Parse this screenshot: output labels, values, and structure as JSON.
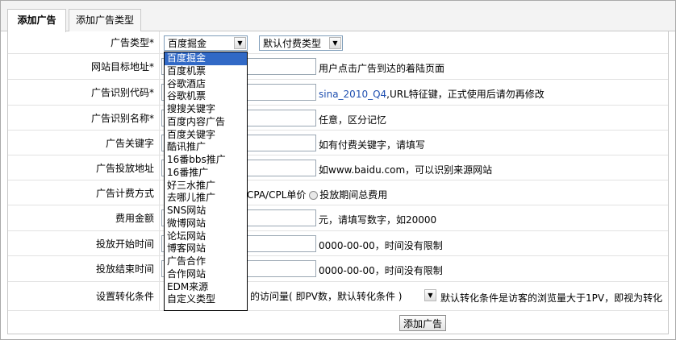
{
  "tabs": [
    {
      "label": "添加广告",
      "active": true
    },
    {
      "label": "添加广告类型",
      "active": false
    }
  ],
  "form": {
    "ad_type_label": "广告类型*",
    "ad_type_value": "百度掘金",
    "pay_type_value": "默认付费类型",
    "target_url_label": "网站目标地址*",
    "target_url_hint": "用户点击广告到达的着陆页面",
    "ad_code_label": "广告识别代码*",
    "ad_code_hint_code": "sina_2010_Q4",
    "ad_code_hint_text": ",URL特征键，正式使用后请勿再修改",
    "ad_name_label": "广告识别名称*",
    "ad_name_hint": "任意，区分记忆",
    "keyword_label": "广告关键字",
    "keyword_hint": "如有付费关键字，请填写",
    "placement_label": "广告投放地址",
    "placement_hint": "如www.baidu.com，可以识别来源网站",
    "billing_label": "广告计费方式",
    "billing_option_partial": "CPA/CPL单价",
    "billing_option_total": "投放期间总费用",
    "amount_label": "费用金额",
    "amount_hint": "元，请填写数字，如20000",
    "start_label": "投放开始时间",
    "start_hint": "0000-00-00，时间没有限制",
    "end_label": "投放结束时间",
    "end_hint": "0000-00-00，时间没有限制",
    "conversion_label": "设置转化条件",
    "conversion_select_value": "的访问量( 即PV数，默认转化条件 )",
    "conversion_hint": "默认转化条件是访客的浏览量大于1PV，即视为转化",
    "submit_label": "添加广告"
  },
  "dropdown_options": [
    "百度掘金",
    "百度机票",
    "谷歌酒店",
    "谷歌机票",
    "搜搜关键字",
    "百度内容广告",
    "百度关键字",
    "酷讯推广",
    "16番bbs推广",
    "16番推广",
    "好三水推广",
    "去哪儿推广",
    "SNS网站",
    "微博网站",
    "论坛网站",
    "博客网站",
    "广告合作",
    "合作网站",
    "EDM来源",
    "自定义类型"
  ],
  "icons": {
    "dropdown_arrow": "chevron-down-icon",
    "radio": "radio-icon"
  }
}
